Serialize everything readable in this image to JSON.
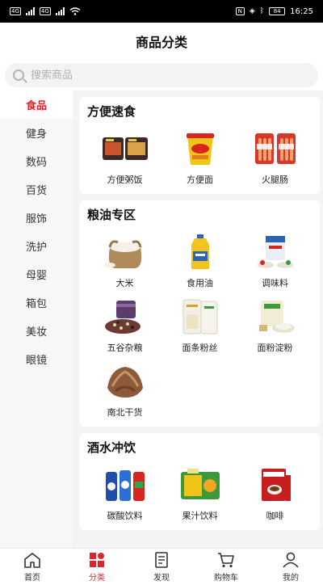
{
  "status_bar": {
    "time": "16:25",
    "sim1": "4G",
    "sim2": "4G",
    "battery": "84"
  },
  "header": {
    "title": "商品分类"
  },
  "search": {
    "placeholder": "搜索商品"
  },
  "sidebar": {
    "items": [
      {
        "label": "食品"
      },
      {
        "label": "健身"
      },
      {
        "label": "数码"
      },
      {
        "label": "百货"
      },
      {
        "label": "服饰"
      },
      {
        "label": "洗护"
      },
      {
        "label": "母婴"
      },
      {
        "label": "箱包"
      },
      {
        "label": "美妆"
      },
      {
        "label": "眼镜"
      }
    ]
  },
  "sections": [
    {
      "title": "方便速食",
      "items": [
        {
          "label": "方便粥饭"
        },
        {
          "label": "方便面"
        },
        {
          "label": "火腿肠"
        }
      ]
    },
    {
      "title": "粮油专区",
      "items": [
        {
          "label": "大米"
        },
        {
          "label": "食用油"
        },
        {
          "label": "调味料"
        },
        {
          "label": "五谷杂粮"
        },
        {
          "label": "面条粉丝"
        },
        {
          "label": "面粉淀粉"
        },
        {
          "label": "南北干货"
        }
      ]
    },
    {
      "title": "酒水冲饮",
      "items": [
        {
          "label": "碳酸饮料"
        },
        {
          "label": "果汁饮料"
        },
        {
          "label": "咖啡"
        }
      ]
    }
  ],
  "tabbar": {
    "items": [
      {
        "label": "首页"
      },
      {
        "label": "分类"
      },
      {
        "label": "发现"
      },
      {
        "label": "购物车"
      },
      {
        "label": "我的"
      }
    ]
  },
  "colors": {
    "accent": "#e0242e"
  }
}
